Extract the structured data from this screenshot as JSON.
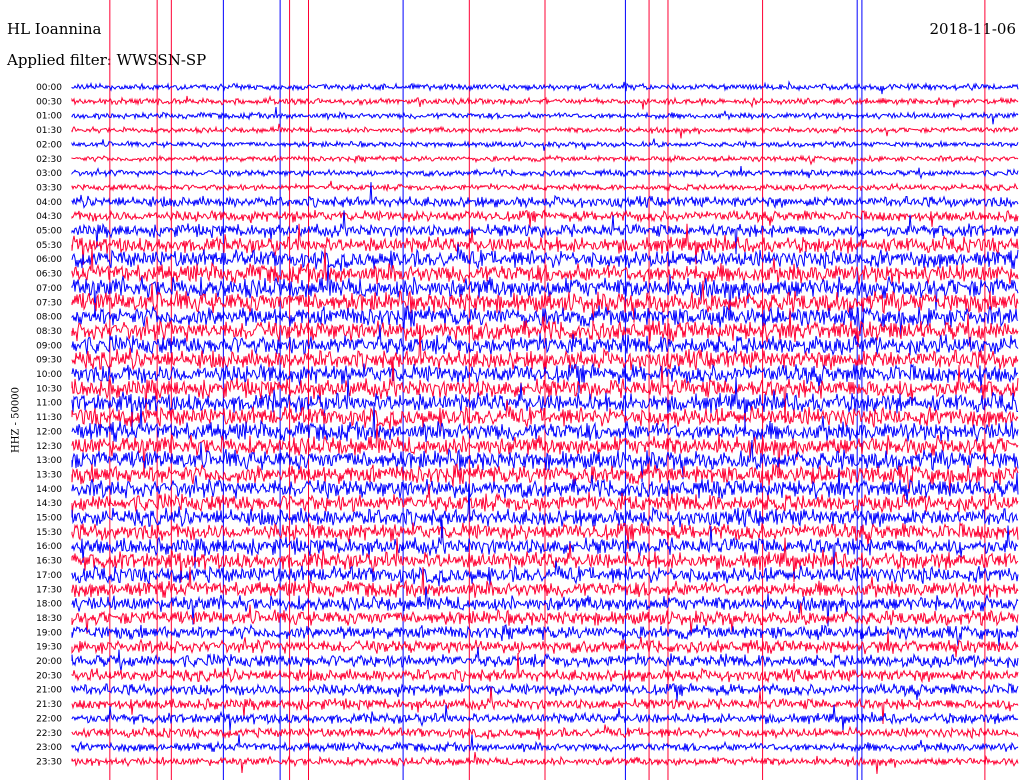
{
  "header": {
    "station": "HL Ioannina",
    "date": "2018-11-06",
    "filter": "Applied filter: WWSSN-SP"
  },
  "channel_label": "HHZ - 50000",
  "colors": {
    "a": "#0000ff",
    "b": "#ff0033"
  },
  "chart_data": {
    "type": "line",
    "title": "HL Ioannina",
    "subtitle": "Applied filter: WWSSN-SP",
    "date": "2018-11-06",
    "ylabel": "HHZ - 50000",
    "grid": false,
    "series_color_cycle": [
      "#0000ff",
      "#ff0033"
    ],
    "rows": [
      "00:00",
      "00:30",
      "01:00",
      "01:30",
      "02:00",
      "02:30",
      "03:00",
      "03:30",
      "04:00",
      "04:30",
      "05:00",
      "05:30",
      "06:00",
      "06:30",
      "07:00",
      "07:30",
      "08:00",
      "08:30",
      "09:00",
      "09:30",
      "10:00",
      "10:30",
      "11:00",
      "11:30",
      "12:00",
      "12:30",
      "13:00",
      "13:30",
      "14:00",
      "14:30",
      "15:00",
      "15:30",
      "16:00",
      "16:30",
      "17:00",
      "17:30",
      "18:00",
      "18:30",
      "19:00",
      "19:30",
      "20:00",
      "20:30",
      "21:00",
      "21:30",
      "22:00",
      "22:30",
      "23:00",
      "23:30"
    ],
    "noise_level": [
      0.9,
      0.9,
      0.9,
      0.8,
      0.8,
      0.8,
      0.9,
      0.9,
      1.6,
      1.6,
      1.9,
      2.3,
      2.6,
      2.8,
      3.0,
      3.0,
      2.9,
      2.9,
      2.8,
      2.8,
      2.8,
      2.8,
      2.8,
      2.8,
      2.8,
      2.8,
      2.8,
      2.8,
      2.7,
      2.6,
      2.6,
      2.5,
      2.5,
      2.5,
      2.4,
      2.3,
      2.2,
      2.1,
      2.0,
      1.9,
      1.9,
      1.8,
      1.7,
      1.6,
      1.5,
      1.4,
      1.3,
      1.2
    ],
    "spikes_red": [
      0.04,
      0.09,
      0.105,
      0.23,
      0.25,
      0.42,
      0.5,
      0.61,
      0.63,
      0.73,
      0.965
    ],
    "spikes_blue": [
      0.16,
      0.22,
      0.35,
      0.585,
      0.83,
      0.835
    ]
  }
}
